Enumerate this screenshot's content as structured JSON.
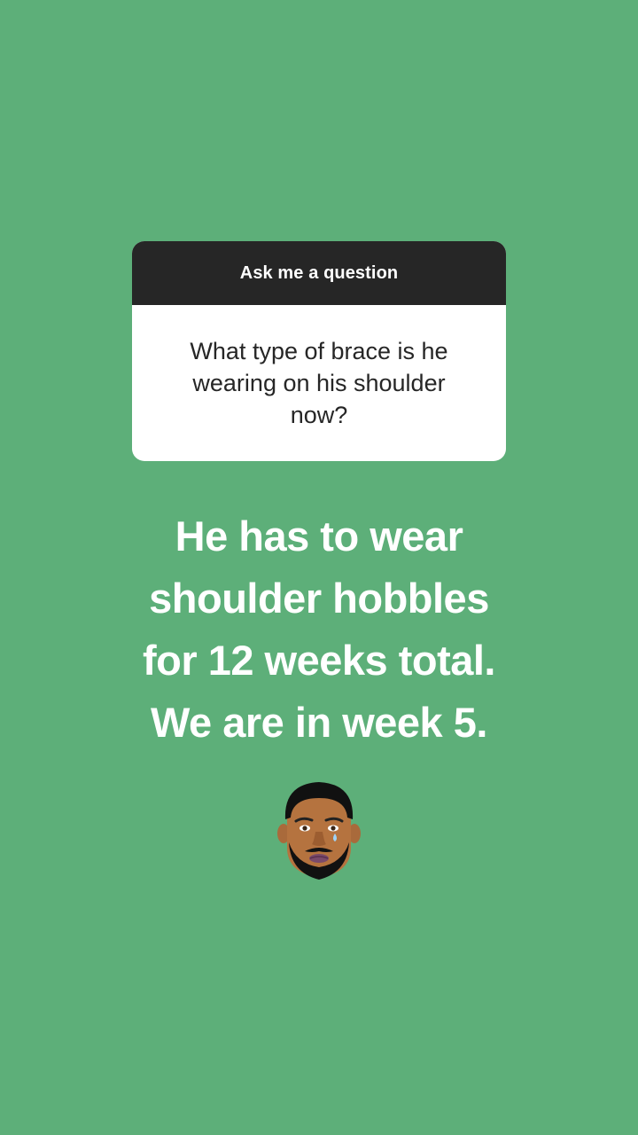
{
  "question_sticker": {
    "title": "Ask me a question",
    "question": "What type of brace is he wearing on his shoulder now?"
  },
  "answer": {
    "text": "He has to wear\nshoulder hobbles\nfor 12 weeks total.\nWe are in week 5."
  },
  "emoji": {
    "icon": "crying-man-memoji-icon"
  },
  "colors": {
    "background": "#5daf79",
    "card_header": "#262626",
    "card_body": "#ffffff",
    "answer_text": "#ffffff"
  }
}
